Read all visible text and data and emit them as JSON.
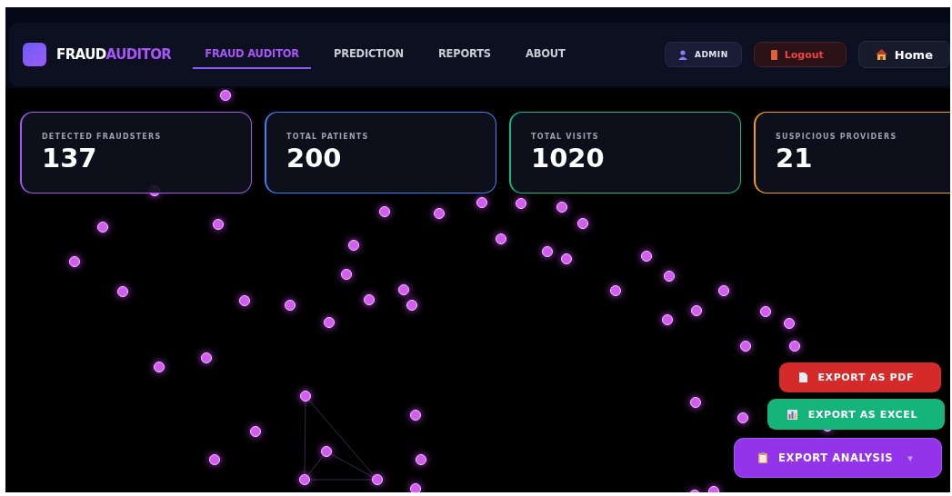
{
  "brand": {
    "text_1": "FRAUD",
    "text_2": "AUDITOR"
  },
  "nav": [
    {
      "label": "FRAUD AUDITOR",
      "selected": true
    },
    {
      "label": "PREDICTION",
      "selected": false
    },
    {
      "label": "REPORTS",
      "selected": false
    },
    {
      "label": "ABOUT",
      "selected": false
    }
  ],
  "user_badge": "ADMIN",
  "logout_button": "Logout",
  "home_button": "Home",
  "stats": [
    {
      "label": "DETECTED FRAUDSTERS",
      "value": "137",
      "color": "#a855f7"
    },
    {
      "label": "TOTAL PATIENTS",
      "value": "200",
      "color": "#3b82f6"
    },
    {
      "label": "TOTAL VISITS",
      "value": "1020",
      "color": "#10b981"
    },
    {
      "label": "SUSPICIOUS PROVIDERS",
      "value": "21",
      "color": "#f59e0b"
    }
  ],
  "export_menu": {
    "label": "EXPORT ANALYSIS",
    "caret": "▾",
    "expanded": true,
    "items": [
      {
        "label": "EXPORT AS PDF",
        "kind": "pdf",
        "color": "#d42a2a"
      },
      {
        "label": "EXPORT AS EXCEL",
        "kind": "excel",
        "color": "#14b47a"
      }
    ]
  }
}
